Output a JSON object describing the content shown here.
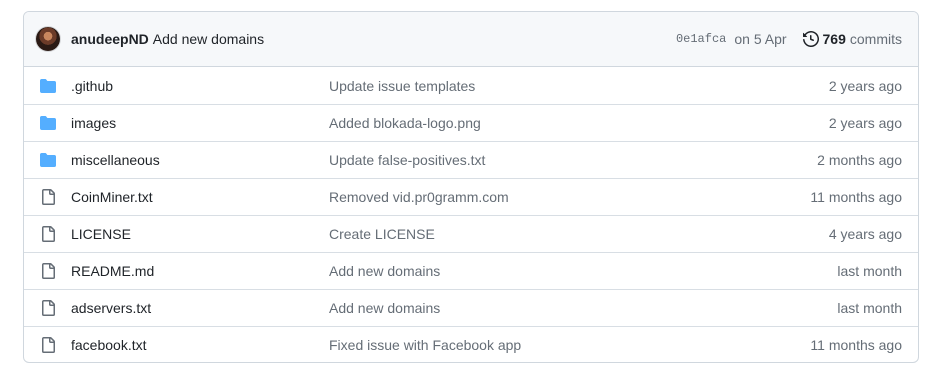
{
  "latest_commit": {
    "author": "anudeepND",
    "message": "Add new domains",
    "sha": "0e1afca",
    "date": "on 5 Apr",
    "commit_count": "769",
    "commits_label": "commits"
  },
  "colors": {
    "folder": "#54aeff",
    "file": "#656d76",
    "border": "#d0d7de",
    "header_bg": "#f6f8fa"
  },
  "files": [
    {
      "type": "folder",
      "icon": "folder-icon",
      "name": ".github",
      "message": "Update issue templates",
      "age": "2 years ago"
    },
    {
      "type": "folder",
      "icon": "folder-icon",
      "name": "images",
      "message": "Added blokada-logo.png",
      "age": "2 years ago"
    },
    {
      "type": "folder",
      "icon": "folder-icon",
      "name": "miscellaneous",
      "message": "Update false-positives.txt",
      "age": "2 months ago"
    },
    {
      "type": "file",
      "icon": "file-icon",
      "name": "CoinMiner.txt",
      "message": "Removed vid.pr0gramm.com",
      "age": "11 months ago"
    },
    {
      "type": "file",
      "icon": "file-icon",
      "name": "LICENSE",
      "message": "Create LICENSE",
      "age": "4 years ago"
    },
    {
      "type": "file",
      "icon": "file-icon",
      "name": "README.md",
      "message": "Add new domains",
      "age": "last month"
    },
    {
      "type": "file",
      "icon": "file-icon",
      "name": "adservers.txt",
      "message": "Add new domains",
      "age": "last month"
    },
    {
      "type": "file",
      "icon": "file-icon",
      "name": "facebook.txt",
      "message": "Fixed issue with Facebook app",
      "age": "11 months ago"
    }
  ]
}
